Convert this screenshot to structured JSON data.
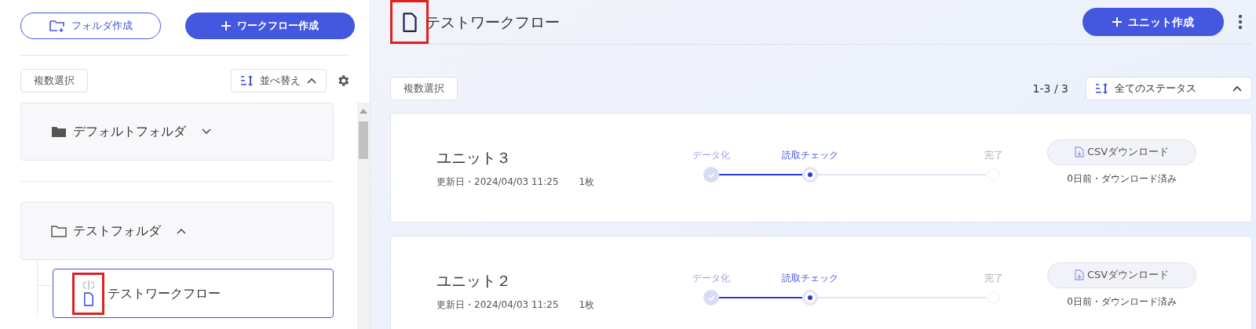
{
  "sidebar": {
    "folder_button": "フォルダ作成",
    "workflow_button": "ワークフロー作成",
    "multi_select": "複数選択",
    "sort": "並べ替え",
    "folders": [
      {
        "name": "デフォルトフォルダ",
        "expanded": false
      },
      {
        "name": "テストフォルダ",
        "expanded": true,
        "children": [
          {
            "name": "テストワークフロー",
            "selected": true
          }
        ]
      }
    ]
  },
  "main": {
    "title": "テストワークフロー",
    "unit_button": "ユニット作成",
    "multi_select": "複数選択",
    "count": "1-3 / 3",
    "status_filter": "全てのステータス",
    "units": [
      {
        "name": "ユニット３",
        "updated": "更新日・2024/04/03 11:25",
        "pages": "1枚",
        "steps": [
          {
            "label": "データ化",
            "kind": "done"
          },
          {
            "label": "読取チェック",
            "kind": "current"
          },
          {
            "label": "完了",
            "kind": "todo"
          }
        ],
        "csv_button": "CSVダウンロード",
        "note": "0日前・ダウンロード済み"
      },
      {
        "name": "ユニット２",
        "updated": "更新日・2024/04/03 11:25",
        "pages": "1枚",
        "steps": [
          {
            "label": "データ化",
            "kind": "done"
          },
          {
            "label": "読取チェック",
            "kind": "current"
          },
          {
            "label": "完了",
            "kind": "todo"
          }
        ],
        "csv_button": "CSVダウンロード",
        "note": "0日前・ダウンロード済み"
      }
    ]
  }
}
